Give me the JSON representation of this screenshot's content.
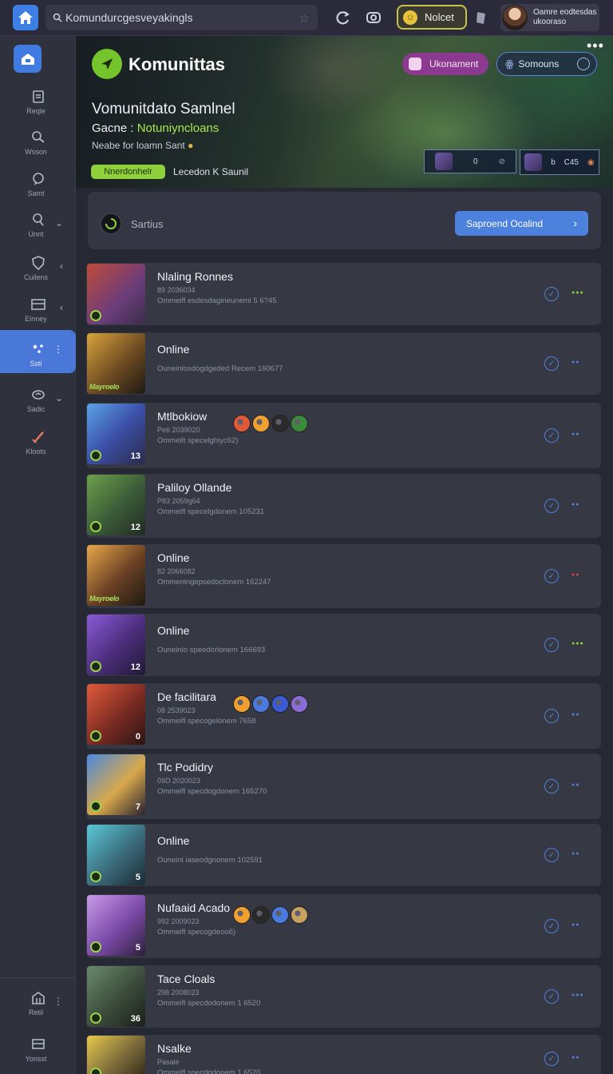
{
  "topbar": {
    "search_value": "Komundurcgesveyakingls",
    "notif_label": "Nolcet",
    "user_text": "Oamre eodtesdas ukooraso"
  },
  "sidebar": {
    "items": [
      {
        "label": "Reqle"
      },
      {
        "label": "Wsson"
      },
      {
        "label": "Samt"
      },
      {
        "label": "Unnt"
      },
      {
        "label": "Cuilens"
      },
      {
        "label": "Einney"
      },
      {
        "label": "Ssti"
      },
      {
        "label": "Sadic"
      },
      {
        "label": "Kloots"
      }
    ],
    "bottom": [
      {
        "label": "Retil"
      },
      {
        "label": "Yonsst"
      }
    ]
  },
  "hero": {
    "title": "Komunittas",
    "pill1": "Ukonament",
    "pill2": "Somouns",
    "subtitle": "Vomunitdato Samlnel",
    "game_label": "Gacne :",
    "game_value": "Notuniyncloans",
    "mode": "Neabe for loamn Sant",
    "tag": "Nnerdonhelr",
    "leader": "Lecedon K Saunil",
    "map1": [
      "0",
      "N"
    ],
    "map2": [
      "b",
      "C45"
    ]
  },
  "status": {
    "label": "Sartius",
    "button": "Saproend Ocalind"
  },
  "rows": [
    {
      "name": "Nlaling Ronnes",
      "sub1": "89 2036034",
      "sub2": "Ommeifl esdesdagineuneml 5 6?45",
      "level": "",
      "dots": "green"
    },
    {
      "name": "Online",
      "sub1": "",
      "sub2": "Ouneinlosdogdgeded Recem 160677",
      "level": "",
      "dots": "blue"
    },
    {
      "name": "Mtlbokiow",
      "sub1": "Pe6 2039020",
      "sub2": "Ommeilt specelghiyc62)",
      "level": "13",
      "dots": "blue"
    },
    {
      "name": "Paliloy Ollande",
      "sub1": "P83 2059g64",
      "sub2": "Ommeifl specelgdonem 105231",
      "level": "12",
      "dots": "blue"
    },
    {
      "name": "Online",
      "sub1": "82 2066082",
      "sub2": "Ommeningepsedoclonem 162247",
      "level": "",
      "dots": "red"
    },
    {
      "name": "Online",
      "sub1": "",
      "sub2": "Ouneinlo speedorlonem 166693",
      "level": "12",
      "dots": "green"
    },
    {
      "name": "De facilitara",
      "sub1": "08 2539023",
      "sub2": "Ommeifl specogelonem 7658",
      "level": "0",
      "dots": "blue"
    },
    {
      "name": "Tlc Podidry",
      "sub1": "09D 2020023",
      "sub2": "Ommeifl specdogdonem 165270",
      "level": "7",
      "dots": "blue"
    },
    {
      "name": "Online",
      "sub1": "",
      "sub2": "Ouneinl iaseodgnonem 102591",
      "level": "5",
      "dots": "blue"
    },
    {
      "name": "Nufaaid Acado",
      "sub1": "992 2009023",
      "sub2": "Ommeifl specogdeoo6)",
      "level": "5",
      "dots": "blue"
    },
    {
      "name": "Tace Cloals",
      "sub1": "298 2008023",
      "sub2": "Ommeifl specdodonem 1 6520",
      "level": "36",
      "dots": "blue"
    },
    {
      "name": "Nsalke",
      "sub1": "Pasale",
      "sub2": "Ommeifl specdodonem 1 6520",
      "level": "",
      "dots": "blue"
    }
  ]
}
